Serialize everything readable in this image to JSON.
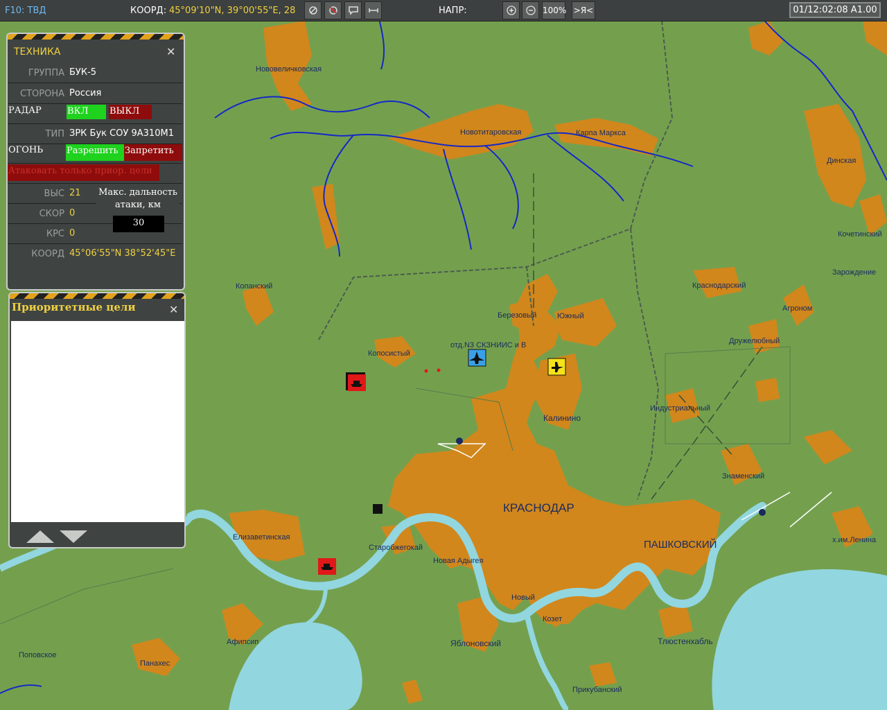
{
  "topbar": {
    "mode_label": "F10: ТВД",
    "coord_label": "КООРД:",
    "coord_value": "45°09'10\"N, 39°00'55\"E, 28",
    "heading_label": "НАПР:",
    "zoom_level": "100%",
    "self_button": ">Я<",
    "time_display": "01/12:02:08 A1.00",
    "tool_icons": [
      "satellite-icon",
      "satellite-off-icon",
      "comment-icon",
      "ruler-icon"
    ]
  },
  "vehicle_panel": {
    "title": "ТЕХНИКА",
    "close": "✕",
    "group_label": "ГРУППА",
    "group_value": "БУК-5",
    "side_label": "СТОРОНА",
    "side_value": "Россия",
    "radar_label": "РАДАР",
    "radar_on": "ВКЛ",
    "radar_off": "ВЫКЛ",
    "type_label": "ТИП",
    "type_value": "ЗРК Бук СОУ 9А310М1",
    "fire_label": "ОГОНЬ",
    "fire_allow": "Разрешить",
    "fire_deny": "Запретить",
    "priority_only": "Атаковать только приор. цели",
    "alt_label": "ВЫС",
    "alt_value": "21",
    "speed_label": "СКОР",
    "speed_value": "0",
    "course_label": "КРС",
    "course_value": "0",
    "max_range_label": "Макс. дальность атаки, км",
    "max_range_value": "30",
    "coord_label": "КООРД",
    "coord_value": "45°06'55\"N  38°52'45\"E"
  },
  "targets_panel": {
    "title": "Приоритетные цели",
    "close": "✕"
  },
  "map_labels": [
    "Нововеличковская",
    "Новотитаровская",
    "Карпа Маркса",
    "Динская",
    "Кочетинский",
    "Зарождение",
    "Копанский",
    "Краснодарский",
    "Агроном",
    "Березовый",
    "Южный",
    "отд.N3 СКЗНИИС и В",
    "Копосистый",
    "Дружелюбный",
    "Калинино",
    "Индустриальный",
    "КРАСНОДАР",
    "Знаменский",
    "ПАШКОВСКИЙ",
    "х.им.Ленина",
    "Елизаветинская",
    "Старобжегокай",
    "Новая Адыгея",
    "Новый",
    "Козет",
    "Тлюстенхабль",
    "Афипсип",
    "Яблоновский",
    "Поповское",
    "Панахес",
    "Прикубанский"
  ],
  "colors": {
    "land": "#74a04e",
    "urban": "#d1871c",
    "water": "#92d6e0",
    "river": "#1428c8",
    "panel_bg": "#3f4443",
    "accent_yellow": "#f0d040",
    "on_green": "#1ed21e",
    "off_red": "#8e0c0c"
  }
}
